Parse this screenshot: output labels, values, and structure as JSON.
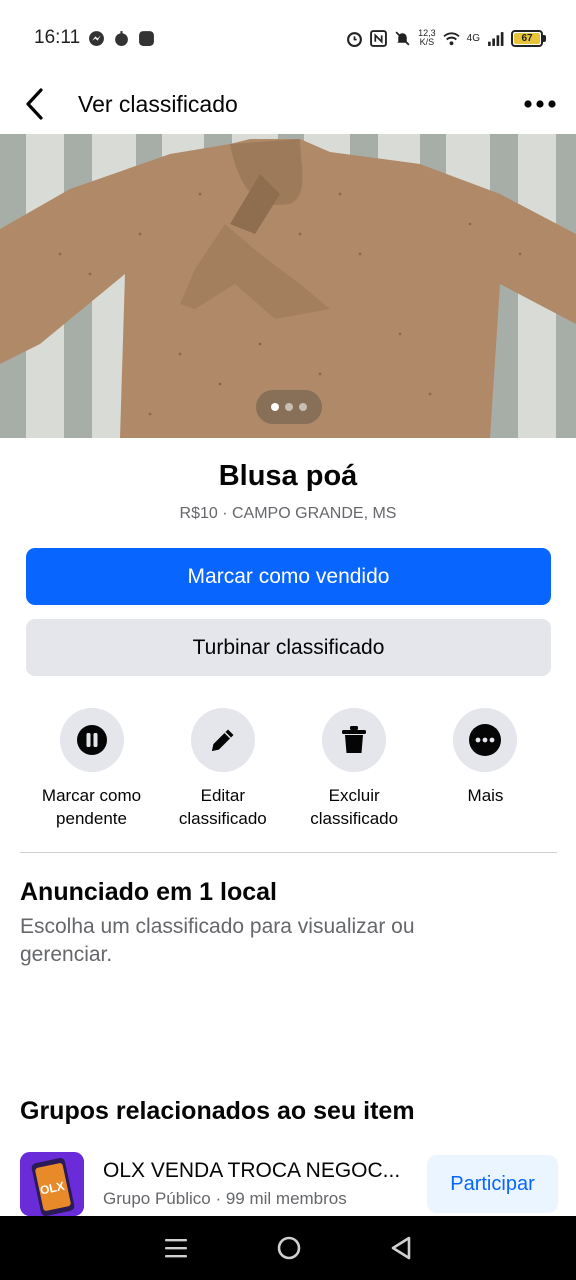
{
  "status_bar": {
    "time": "16:11",
    "net_speed_value": "12,3",
    "net_speed_unit": "K/S",
    "network": "4G",
    "battery": "67",
    "icons": [
      "messenger-icon",
      "location-icon",
      "app-icon",
      "alarm-icon",
      "nfc-icon",
      "mute-icon",
      "wifi-icon",
      "signal-icon",
      "battery-icon"
    ]
  },
  "header": {
    "title": "Ver classificado",
    "back_icon": "chevron-left-icon",
    "more_icon": "more-horizontal-icon"
  },
  "photo": {
    "dot_count": 3,
    "active_dot": 0
  },
  "listing": {
    "title": "Blusa poá",
    "meta": "R$10 · CAMPO GRANDE, MS"
  },
  "buttons": {
    "mark_sold": "Marcar como vendido",
    "boost": "Turbinar classificado"
  },
  "actions": [
    {
      "label": "Marcar como pendente",
      "icon": "pause-icon"
    },
    {
      "label": "Editar classificado",
      "icon": "pencil-icon"
    },
    {
      "label": "Excluir classificado",
      "icon": "trash-icon"
    },
    {
      "label": "Mais",
      "icon": "more-horizontal-icon"
    }
  ],
  "listed_in": {
    "title": "Anunciado em 1 local",
    "description": "Escolha um classificado para visualizar ou gerenciar."
  },
  "related_groups": {
    "title": "Grupos relacionados ao seu item",
    "items": [
      {
        "name": "OLX VENDA TROCA NEGOC...",
        "subtitle": "Grupo Público · 99 mil membros",
        "button": "Participar",
        "thumb_text": "OLX"
      }
    ]
  },
  "colors": {
    "primary": "#0866ff",
    "secondary_bg": "#e4e6eb",
    "muted_text": "#65676b",
    "join_bg": "#ebf5ff"
  }
}
